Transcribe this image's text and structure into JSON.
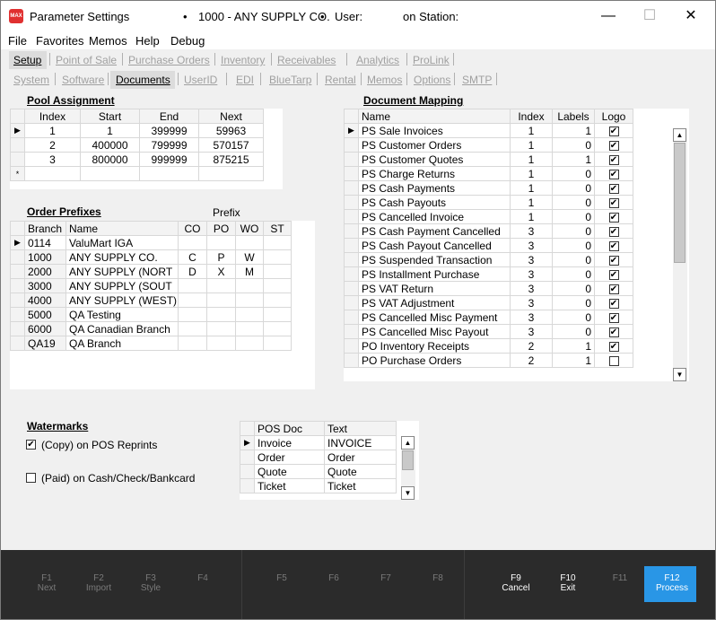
{
  "title": {
    "app": "Parameter Settings",
    "bullet1": "•",
    "branch": "1000 - ANY SUPPLY CO.",
    "bullet2": "•",
    "user_label": "User:",
    "station_label": "on Station:"
  },
  "window_controls": {
    "minimize": "—",
    "maximize": "☐",
    "close": "✕"
  },
  "menu": [
    "File",
    "Favorites",
    "Memos",
    "Help",
    "Debug"
  ],
  "tabs_primary": [
    "Setup",
    "Point of Sale",
    "Purchase Orders",
    "Inventory",
    "Receivables",
    "Analytics",
    "ProLink"
  ],
  "tabs_secondary": [
    "System",
    "Software",
    "Documents",
    "UserID",
    "EDI",
    "BlueTarp",
    "Rental",
    "Memos",
    "Options",
    "SMTP"
  ],
  "pool": {
    "title": "Pool Assignment",
    "headers": [
      "Index",
      "Start",
      "End",
      "Next"
    ],
    "rows": [
      [
        "1",
        "1",
        "399999",
        "59963"
      ],
      [
        "2",
        "400000",
        "799999",
        "570157"
      ],
      [
        "3",
        "800000",
        "999999",
        "875215"
      ]
    ],
    "new_row_marker": "*"
  },
  "prefixes": {
    "title": "Order Prefixes",
    "group_label": "Prefix",
    "headers": [
      "Branch",
      "Name",
      "CO",
      "PO",
      "WO",
      "ST"
    ],
    "rows": [
      [
        "0114",
        "ValuMart IGA",
        "",
        "",
        "",
        ""
      ],
      [
        "1000",
        "ANY SUPPLY CO.",
        "C",
        "P",
        "W",
        ""
      ],
      [
        "2000",
        "ANY SUPPLY (NORT",
        "D",
        "X",
        "M",
        ""
      ],
      [
        "3000",
        "ANY SUPPLY (SOUT",
        "",
        "",
        "",
        ""
      ],
      [
        "4000",
        "ANY SUPPLY (WEST)",
        "",
        "",
        "",
        ""
      ],
      [
        "5000",
        "QA Testing",
        "",
        "",
        "",
        ""
      ],
      [
        "6000",
        "QA Canadian  Branch",
        "",
        "",
        "",
        ""
      ],
      [
        "QA19",
        "QA Branch",
        "",
        "",
        "",
        ""
      ]
    ]
  },
  "mapping": {
    "title": "Document Mapping",
    "headers": [
      "Name",
      "Index",
      "Labels",
      "Logo"
    ],
    "rows": [
      {
        "name": "PS Sale Invoices",
        "index": "1",
        "labels": "1",
        "logo": true
      },
      {
        "name": "PS Customer Orders",
        "index": "1",
        "labels": "0",
        "logo": true
      },
      {
        "name": "PS Customer Quotes",
        "index": "1",
        "labels": "1",
        "logo": true
      },
      {
        "name": "PS Charge Returns",
        "index": "1",
        "labels": "0",
        "logo": true
      },
      {
        "name": "PS Cash Payments",
        "index": "1",
        "labels": "0",
        "logo": true
      },
      {
        "name": "PS Cash Payouts",
        "index": "1",
        "labels": "0",
        "logo": true
      },
      {
        "name": "PS Cancelled Invoice",
        "index": "1",
        "labels": "0",
        "logo": true
      },
      {
        "name": "PS Cash Payment Cancelled",
        "index": "3",
        "labels": "0",
        "logo": true
      },
      {
        "name": "PS Cash Payout Cancelled",
        "index": "3",
        "labels": "0",
        "logo": true
      },
      {
        "name": "PS Suspended Transaction",
        "index": "3",
        "labels": "0",
        "logo": true
      },
      {
        "name": "PS Installment Purchase",
        "index": "3",
        "labels": "0",
        "logo": true
      },
      {
        "name": "PS VAT Return",
        "index": "3",
        "labels": "0",
        "logo": true
      },
      {
        "name": "PS VAT Adjustment",
        "index": "3",
        "labels": "0",
        "logo": true
      },
      {
        "name": "PS Cancelled Misc Payment",
        "index": "3",
        "labels": "0",
        "logo": true
      },
      {
        "name": "PS Cancelled Misc Payout",
        "index": "3",
        "labels": "0",
        "logo": true
      },
      {
        "name": "PO Inventory Receipts",
        "index": "2",
        "labels": "1",
        "logo": true
      },
      {
        "name": "PO Purchase Orders",
        "index": "2",
        "labels": "1",
        "logo": false
      }
    ]
  },
  "watermarks": {
    "title": "Watermarks",
    "copy_label": "(Copy) on POS Reprints",
    "copy_checked": true,
    "paid_label": "(Paid) on Cash/Check/Bankcard",
    "paid_checked": false
  },
  "pos_docs": {
    "headers": [
      "POS Doc",
      "Text"
    ],
    "rows": [
      [
        "Invoice",
        "INVOICE"
      ],
      [
        "Order",
        "Order"
      ],
      [
        "Quote",
        "Quote"
      ],
      [
        "Ticket",
        "Ticket"
      ]
    ]
  },
  "function_keys": [
    {
      "key": "F1",
      "label": "Next",
      "enabled": false
    },
    {
      "key": "F2",
      "label": "Import",
      "enabled": false
    },
    {
      "key": "F3",
      "label": "Style",
      "enabled": false
    },
    {
      "key": "F4",
      "label": "",
      "enabled": false
    },
    {
      "key": "F5",
      "label": "",
      "enabled": false
    },
    {
      "key": "F6",
      "label": "",
      "enabled": false
    },
    {
      "key": "F7",
      "label": "",
      "enabled": false
    },
    {
      "key": "F8",
      "label": "",
      "enabled": false
    },
    {
      "key": "F9",
      "label": "Cancel",
      "enabled": true
    },
    {
      "key": "F10",
      "label": "Exit",
      "enabled": true
    },
    {
      "key": "F11",
      "label": "",
      "enabled": false
    },
    {
      "key": "F12",
      "label": "Process",
      "enabled": true
    }
  ],
  "colors": {
    "accent": "#2996e6",
    "footer_bg": "#2b2b2b",
    "app_icon": "#e03030"
  }
}
